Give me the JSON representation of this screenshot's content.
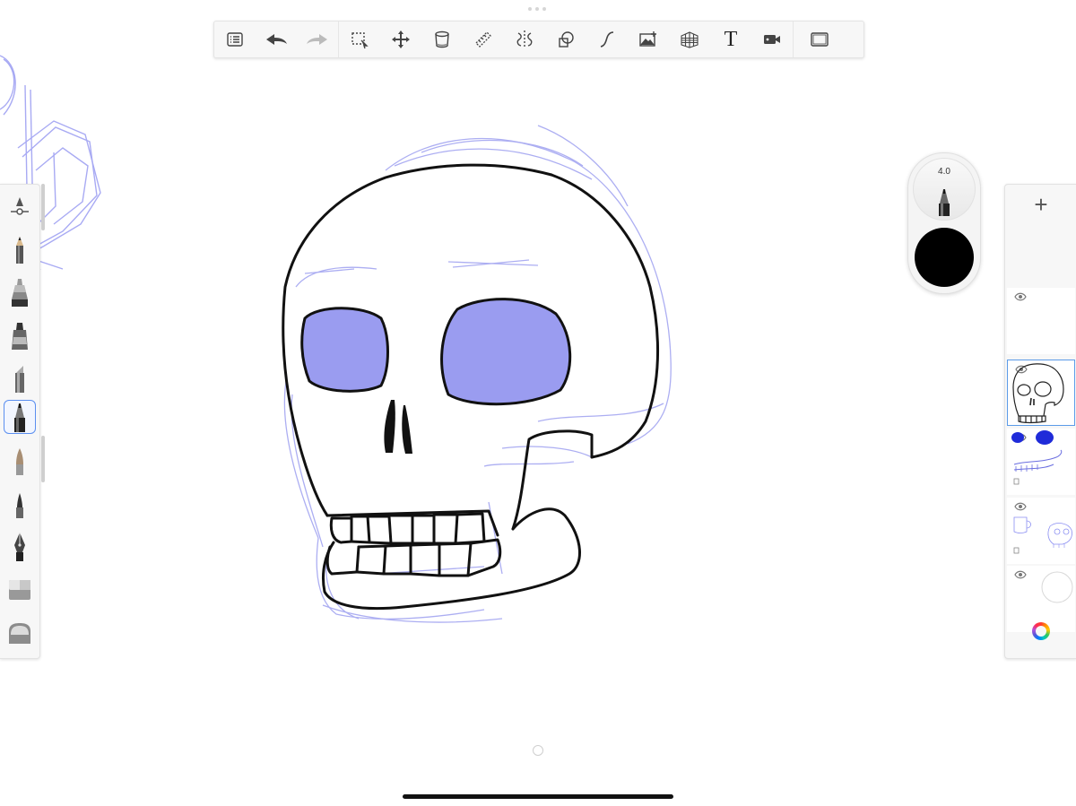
{
  "app": {
    "brush_size": "4.0",
    "current_color": "#000000",
    "selected_brush_index": 5
  },
  "top_toolbar": {
    "buttons": [
      {
        "name": "gallery-menu-button",
        "icon": "list-icon"
      },
      {
        "name": "undo-button",
        "icon": "undo-icon"
      },
      {
        "name": "redo-button",
        "icon": "redo-icon"
      },
      {
        "name": "selection-tool-button",
        "icon": "selection-icon"
      },
      {
        "name": "transform-tool-button",
        "icon": "move-icon"
      },
      {
        "name": "fill-tool-button",
        "icon": "bucket-icon"
      },
      {
        "name": "ruler-tool-button",
        "icon": "ruler-icon"
      },
      {
        "name": "symmetry-tool-button",
        "icon": "symmetry-icon"
      },
      {
        "name": "shape-tool-button",
        "icon": "shapes-icon"
      },
      {
        "name": "stroke-tool-button",
        "icon": "curve-icon"
      },
      {
        "name": "import-image-button",
        "icon": "image-icon"
      },
      {
        "name": "perspective-guide-button",
        "icon": "perspective-grid-icon"
      },
      {
        "name": "text-tool-button",
        "icon": "text-icon",
        "label": "T"
      },
      {
        "name": "time-lapse-button",
        "icon": "video-icon"
      },
      {
        "name": "fullscreen-button",
        "icon": "fullscreen-icon"
      }
    ]
  },
  "left_toolbar": {
    "brushes": [
      {
        "name": "brush-settings",
        "icon": "brush-settings-icon"
      },
      {
        "name": "pencil",
        "icon": "pencil-icon"
      },
      {
        "name": "ink-pen",
        "icon": "ink-pen-icon"
      },
      {
        "name": "marker",
        "icon": "marker-icon"
      },
      {
        "name": "chisel-marker",
        "icon": "chisel-icon"
      },
      {
        "name": "ballpoint-pen",
        "icon": "ballpoint-icon"
      },
      {
        "name": "airbrush",
        "icon": "airbrush-icon"
      },
      {
        "name": "paint-brush",
        "icon": "paintbrush-icon"
      },
      {
        "name": "fountain-pen",
        "icon": "fountain-pen-icon"
      },
      {
        "name": "smudge",
        "icon": "smudge-icon"
      },
      {
        "name": "eraser",
        "icon": "eraser-icon"
      }
    ]
  },
  "layers": {
    "add_label": "+",
    "items": [
      {
        "name": "layer-1",
        "visible": true,
        "content": "empty"
      },
      {
        "name": "layer-2",
        "visible": true,
        "content": "skull-line-art",
        "active": true
      },
      {
        "name": "layer-3",
        "visible": true,
        "content": "blue-sketch"
      },
      {
        "name": "layer-4",
        "visible": true,
        "content": "rough-sketch"
      },
      {
        "name": "background-layer",
        "visible": true,
        "content": "paper"
      }
    ]
  },
  "colors": {
    "sketch_blue": "#8a8ef2",
    "eye_fill": "#9a9cf0",
    "ink": "#111111",
    "selection_blue": "#5b9be8"
  }
}
